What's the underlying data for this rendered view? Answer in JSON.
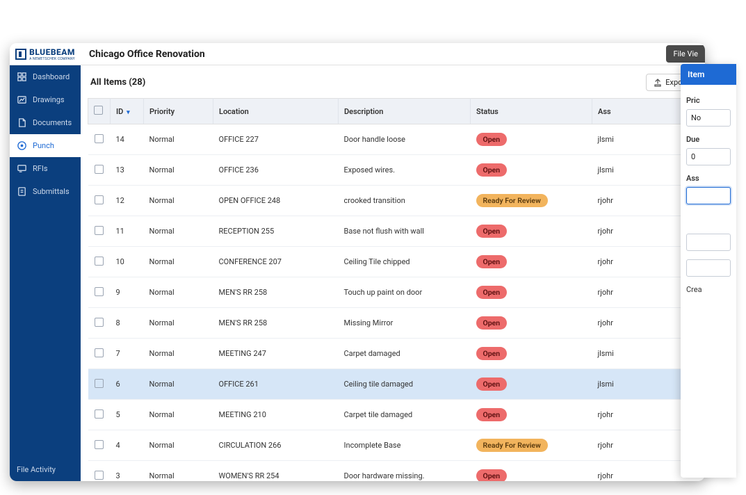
{
  "brand": {
    "name": "BLUEBEAM",
    "tagline": "A NEMETSCHEK COMPANY"
  },
  "project_title": "Chicago Office Renovation",
  "topbar": {
    "file_view": "File Vie"
  },
  "sidebar": {
    "items": [
      {
        "label": "Dashboard",
        "icon": "dashboard-icon"
      },
      {
        "label": "Drawings",
        "icon": "drawings-icon"
      },
      {
        "label": "Documents",
        "icon": "documents-icon"
      },
      {
        "label": "Punch",
        "icon": "punch-icon"
      },
      {
        "label": "RFIs",
        "icon": "rfis-icon"
      },
      {
        "label": "Submittals",
        "icon": "submittals-icon"
      }
    ],
    "active_index": 3,
    "footer": "File Activity"
  },
  "main": {
    "title": "All Items (28)",
    "export_label": "Export",
    "columns": {
      "id": "ID",
      "priority": "Priority",
      "location": "Location",
      "description": "Description",
      "status": "Status",
      "assignee": "Ass"
    },
    "status_labels": {
      "open": "Open",
      "ready": "Ready For Review"
    },
    "selected_row_id": 6,
    "rows": [
      {
        "id": 14,
        "priority": "Normal",
        "location": "OFFICE 227",
        "description": "Door handle loose",
        "status": "open",
        "assignee": "jlsmi"
      },
      {
        "id": 13,
        "priority": "Normal",
        "location": "OFFICE 236",
        "description": "Exposed wires.",
        "status": "open",
        "assignee": "jlsmi"
      },
      {
        "id": 12,
        "priority": "Normal",
        "location": "OPEN OFFICE 248",
        "description": "crooked transition",
        "status": "ready",
        "assignee": "rjohr"
      },
      {
        "id": 11,
        "priority": "Normal",
        "location": "RECEPTION 255",
        "description": "Base not flush with wall",
        "status": "open",
        "assignee": "rjohr"
      },
      {
        "id": 10,
        "priority": "Normal",
        "location": "CONFERENCE 207",
        "description": "Ceiling Tile chipped",
        "status": "open",
        "assignee": "rjohr"
      },
      {
        "id": 9,
        "priority": "Normal",
        "location": "MEN'S RR 258",
        "description": "Touch up paint on door",
        "status": "open",
        "assignee": "rjohr"
      },
      {
        "id": 8,
        "priority": "Normal",
        "location": "MEN'S RR 258",
        "description": "Missing Mirror",
        "status": "open",
        "assignee": "rjohr"
      },
      {
        "id": 7,
        "priority": "Normal",
        "location": "MEETING 247",
        "description": "Carpet damaged",
        "status": "open",
        "assignee": "jlsmi"
      },
      {
        "id": 6,
        "priority": "Normal",
        "location": "OFFICE 261",
        "description": "Ceiling tile damaged",
        "status": "open",
        "assignee": "jlsmi"
      },
      {
        "id": 5,
        "priority": "Normal",
        "location": "MEETING 210",
        "description": "Carpet tile damaged",
        "status": "open",
        "assignee": "rjohr"
      },
      {
        "id": 4,
        "priority": "Normal",
        "location": "CIRCULATION 266",
        "description": "Incomplete Base",
        "status": "ready",
        "assignee": "rjohr"
      },
      {
        "id": 3,
        "priority": "Normal",
        "location": "WOMEN'S RR 254",
        "description": "Door hardware missing.",
        "status": "open",
        "assignee": "rjohr"
      }
    ]
  },
  "side_panel": {
    "tab": "Item",
    "labels": {
      "priority": "Pric",
      "due": "Due",
      "assignees": "Ass",
      "created": "Crea"
    },
    "priority_value": "No",
    "due_value": "0"
  }
}
